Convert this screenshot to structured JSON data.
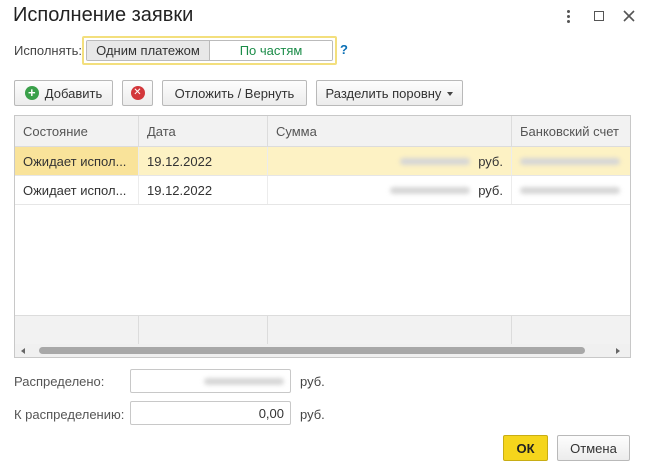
{
  "window": {
    "title": "Исполнение заявки"
  },
  "execute": {
    "label": "Исполнять:",
    "options": [
      "Одним платежом",
      "По частям"
    ],
    "selected": "По частям",
    "help": "?"
  },
  "toolbar": {
    "add_label": "Добавить",
    "postpone_label": "Отложить / Вернуть",
    "split_label": "Разделить поровну"
  },
  "table": {
    "columns": [
      "Состояние",
      "Дата",
      "Сумма",
      "Банковский счет"
    ],
    "rows": [
      {
        "state": "Ожидает испол...",
        "date": "19.12.2022",
        "currency": "руб."
      },
      {
        "state": "Ожидает испол...",
        "date": "19.12.2022",
        "currency": "руб."
      }
    ]
  },
  "summary": {
    "distributed_label": "Распределено:",
    "distributed_unit": "руб.",
    "remaining_label": "К распределению:",
    "remaining_value": "0,00",
    "remaining_unit": "руб."
  },
  "footer": {
    "ok_label": "ОК",
    "cancel_label": "Отмена"
  },
  "colors": {
    "accent": "#f5d51c",
    "selected_row": "#fdf2c4",
    "toggle_active_text": "#1b8c48"
  }
}
